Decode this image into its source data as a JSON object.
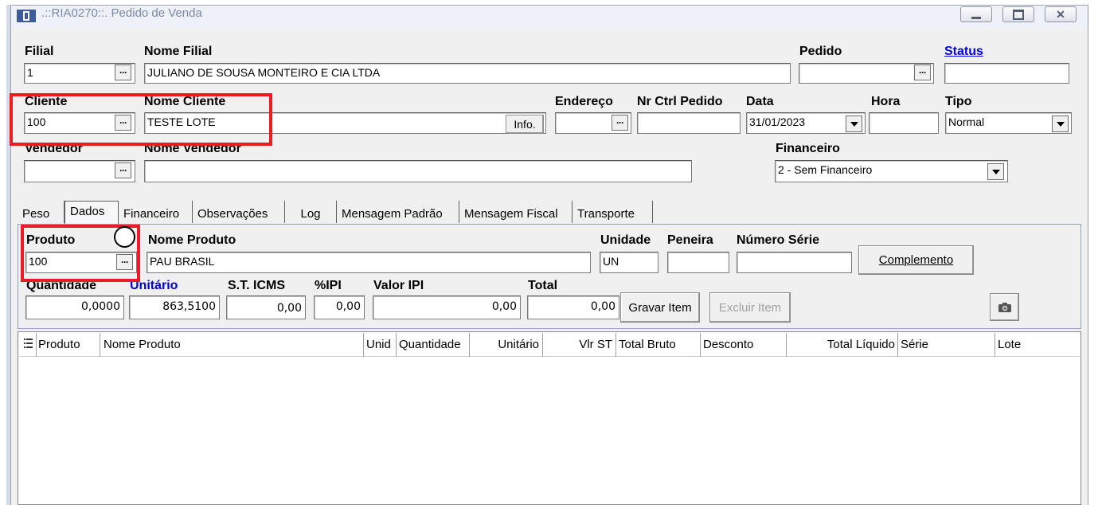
{
  "window": {
    "title": ".::RIA0270::. Pedido de Venda",
    "buttons": [
      "minimize",
      "maximize",
      "close"
    ]
  },
  "header": {
    "filial": {
      "label": "Filial",
      "value": "1"
    },
    "nome_filial": {
      "label": "Nome Filial",
      "value": "JULIANO DE SOUSA MONTEIRO E CIA LTDA"
    },
    "pedido": {
      "label": "Pedido",
      "value": ""
    },
    "status": {
      "label": "Status",
      "value": ""
    },
    "cliente": {
      "label": "Cliente",
      "value": "100"
    },
    "nome_cliente": {
      "label": "Nome Cliente",
      "value": "TESTE LOTE"
    },
    "info_button": "Info.",
    "endereco": {
      "label": "Endereço",
      "value": ""
    },
    "nr_ctrl_pedido": {
      "label": "Nr Ctrl Pedido",
      "value": ""
    },
    "data": {
      "label": "Data",
      "value": "31/01/2023"
    },
    "hora": {
      "label": "Hora",
      "value": ""
    },
    "tipo": {
      "label": "Tipo",
      "value": "Normal"
    },
    "vendedor": {
      "label": "Vendedor",
      "value": ""
    },
    "nome_vendedor": {
      "label": "Nome Vendedor",
      "value": ""
    },
    "financeiro": {
      "label": "Financeiro",
      "value": "2 - Sem Financeiro"
    }
  },
  "tabs": [
    "Peso",
    "Dados",
    "Financeiro",
    "Observações",
    "Log",
    "Mensagem Padrão",
    "Mensagem Fiscal",
    "Transporte"
  ],
  "active_tab": "Dados",
  "item": {
    "produto": {
      "label": "Produto",
      "value": "100"
    },
    "nome_produto": {
      "label": "Nome Produto",
      "value": "PAU BRASIL"
    },
    "unidade": {
      "label": "Unidade",
      "value": "UN"
    },
    "peneira": {
      "label": "Peneira",
      "value": ""
    },
    "numero_serie": {
      "label": "Número Série",
      "value": ""
    },
    "complemento_button": "Complemento",
    "quantidade": {
      "label": "Quantidade",
      "value": "0,0000"
    },
    "unitario": {
      "label": "Unitário",
      "value": "863,5100"
    },
    "st_icms": {
      "label": "S.T. ICMS",
      "value": "0,00"
    },
    "ipi_pct": {
      "label": "%IPI",
      "value": "0,00"
    },
    "valor_ipi": {
      "label": "Valor IPI",
      "value": "0,00"
    },
    "total": {
      "label": "Total",
      "value": "0,00"
    },
    "gravar_button": "Gravar Item",
    "excluir_button": "Excluir Item"
  },
  "grid": {
    "columns": [
      "Produto",
      "Nome Produto",
      "Unid",
      "Quantidade",
      "Unitário",
      "Vlr ST",
      "Total Bruto",
      "Desconto",
      "Total Líquido",
      "Série",
      "Lote"
    ],
    "rows": []
  },
  "colors": {
    "highlight": "#ec1c24",
    "link": "#0000ee",
    "unitario_label": "#0000cc"
  }
}
